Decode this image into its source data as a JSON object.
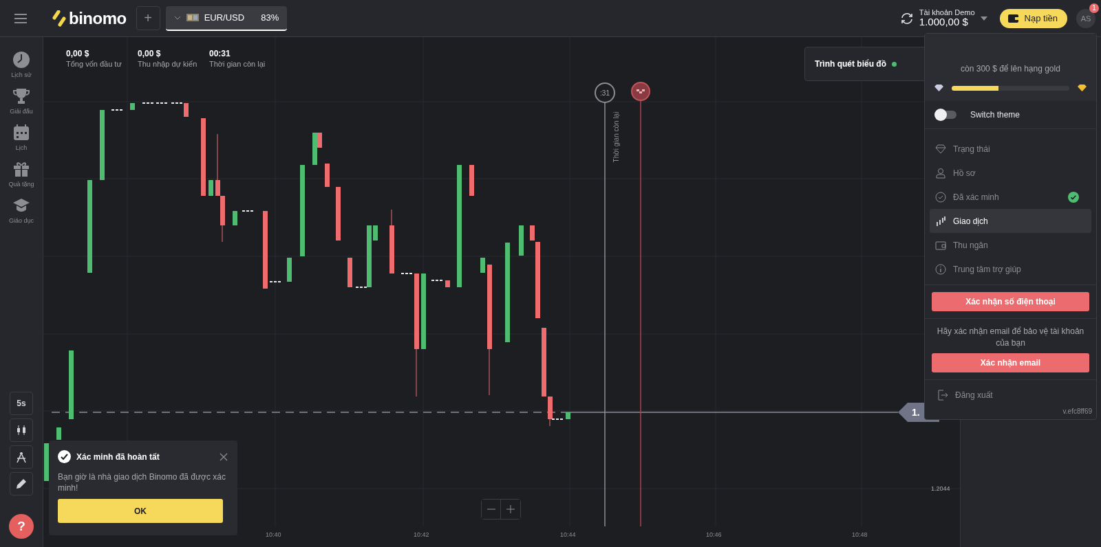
{
  "header": {
    "logo": "binomo",
    "add_label": "+",
    "asset": {
      "name": "EUR/USD",
      "payout": "83%",
      "selected": true
    },
    "account": {
      "type": "Tài khoản Demo",
      "balance": "1.000,00 $"
    },
    "deposit": "Nạp tiền",
    "avatar": {
      "initials": "AS",
      "badge": "1"
    }
  },
  "sidebar": {
    "items": [
      {
        "kind": "history",
        "label": "Lịch sử"
      },
      {
        "kind": "tournaments",
        "label": "Giải đấu"
      },
      {
        "kind": "calendar",
        "label": "Lịch"
      },
      {
        "kind": "gifts",
        "label": "Quà tặng"
      },
      {
        "kind": "education",
        "label": "Giáo dục"
      }
    ],
    "tools": [
      {
        "kind": "interval",
        "label": "5s"
      },
      {
        "kind": "candles"
      },
      {
        "kind": "indicators"
      },
      {
        "kind": "draw"
      }
    ],
    "help": "?"
  },
  "stats": [
    {
      "value": "0,00 $",
      "label": "Tổng vốn đầu tư"
    },
    {
      "value": "0,00 $",
      "label": "Thu nhập dự kiến"
    },
    {
      "value": "00:31",
      "label": "Thời gian còn lại"
    }
  ],
  "scanner": {
    "label": "Trình quét biểu đồ",
    "on": true
  },
  "chart": {
    "timer": ":31",
    "timer_label": "Thời gian còn lại",
    "price_tag": "1.",
    "y_label": "1.2044",
    "x_labels": [
      "10:40",
      "10:42",
      "10:44",
      "10:46",
      "10:48"
    ]
  },
  "toast": {
    "title": "Xác minh đã hoàn tất",
    "body": "Bạn giờ là nhà giao dịch Binomo đã được xác minh!",
    "button": "OK"
  },
  "menu": {
    "progress_text": "còn 300 $ để lên hạng gold",
    "level": 0.4,
    "theme_toggle": {
      "label": "Switch theme",
      "on": false
    },
    "items": [
      {
        "kind": "status",
        "label": "Trạng thái",
        "verified": false,
        "selected": false
      },
      {
        "kind": "profile",
        "label": "Hồ sơ",
        "verified": false,
        "selected": false
      },
      {
        "kind": "verified",
        "label": "Đã xác minh",
        "verified": true,
        "selected": false
      },
      {
        "kind": "trading",
        "label": "Giao dịch",
        "verified": false,
        "selected": true
      },
      {
        "kind": "cashier",
        "label": "Thu ngân",
        "verified": false,
        "selected": false
      },
      {
        "kind": "help",
        "label": "Trung tâm trợ giúp",
        "verified": false,
        "selected": false
      }
    ],
    "phone_button": "Xác nhận số điện thoại",
    "email_note": "Hãy xác nhận email để bảo vệ tài khoản của bạn",
    "email_button": "Xác nhận email",
    "logout": "Đăng xuất",
    "version": "v.efc8ff69"
  }
}
